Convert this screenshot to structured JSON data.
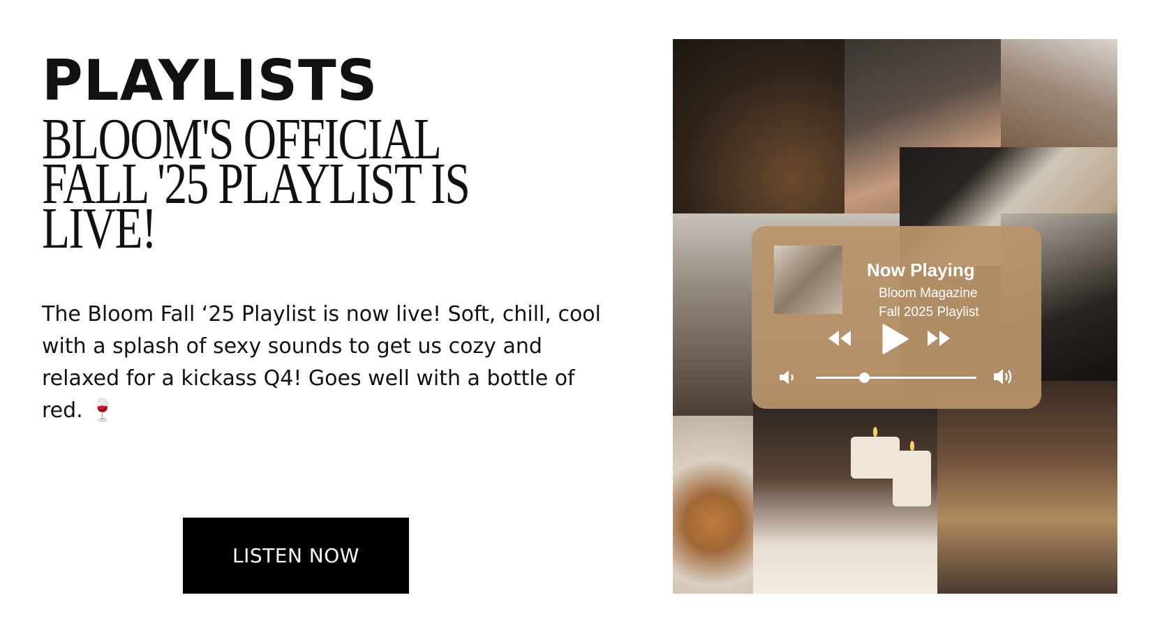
{
  "section_label": "PLAYLISTS",
  "headline": {
    "line1": "BLOOM'S OFFICIAL",
    "line2": "FALL '25 PLAYLIST IS",
    "line3": "LIVE!"
  },
  "description": "The Bloom Fall ‘25 Playlist is now live! Soft, chill, cool with a splash of sexy sounds to get us cozy and relaxed for a kickass Q4! Goes well with a bottle of red.",
  "description_emoji": "🍷",
  "cta_label": "LISTEN NOW",
  "player": {
    "heading": "Now Playing",
    "artist": "Bloom Magazine",
    "track": "Fall 2025 Playlist",
    "progress": 0.3,
    "background_color": "#BA946C"
  },
  "icons": {
    "rewind": "rewind-icon",
    "play": "play-icon",
    "fast_forward": "fast-forward-icon",
    "volume_low": "volume-low-icon",
    "volume_high": "volume-high-icon"
  }
}
